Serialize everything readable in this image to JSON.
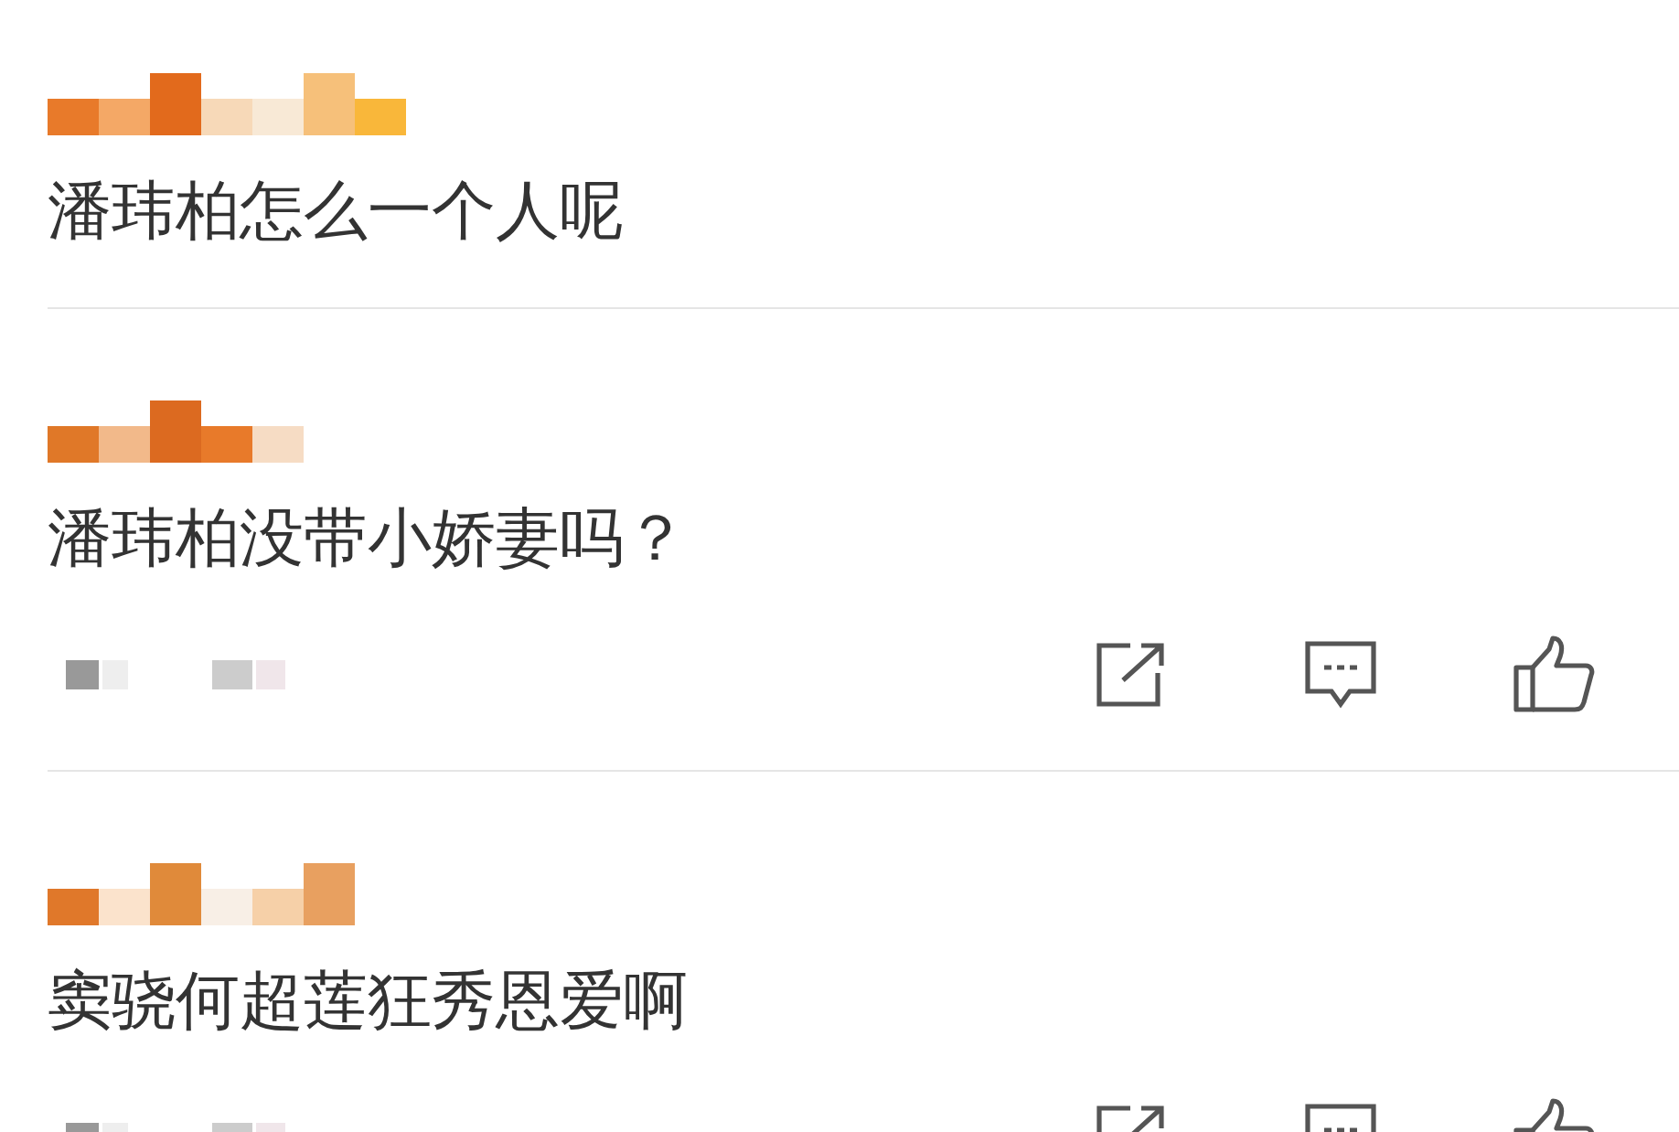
{
  "comments": [
    {
      "text": "潘玮柏怎么一个人呢",
      "actions": false
    },
    {
      "text": "潘玮柏没带小娇妻吗？",
      "actions": true
    },
    {
      "text": "窦骁何超莲狂秀恩爱啊",
      "actions": true
    }
  ]
}
